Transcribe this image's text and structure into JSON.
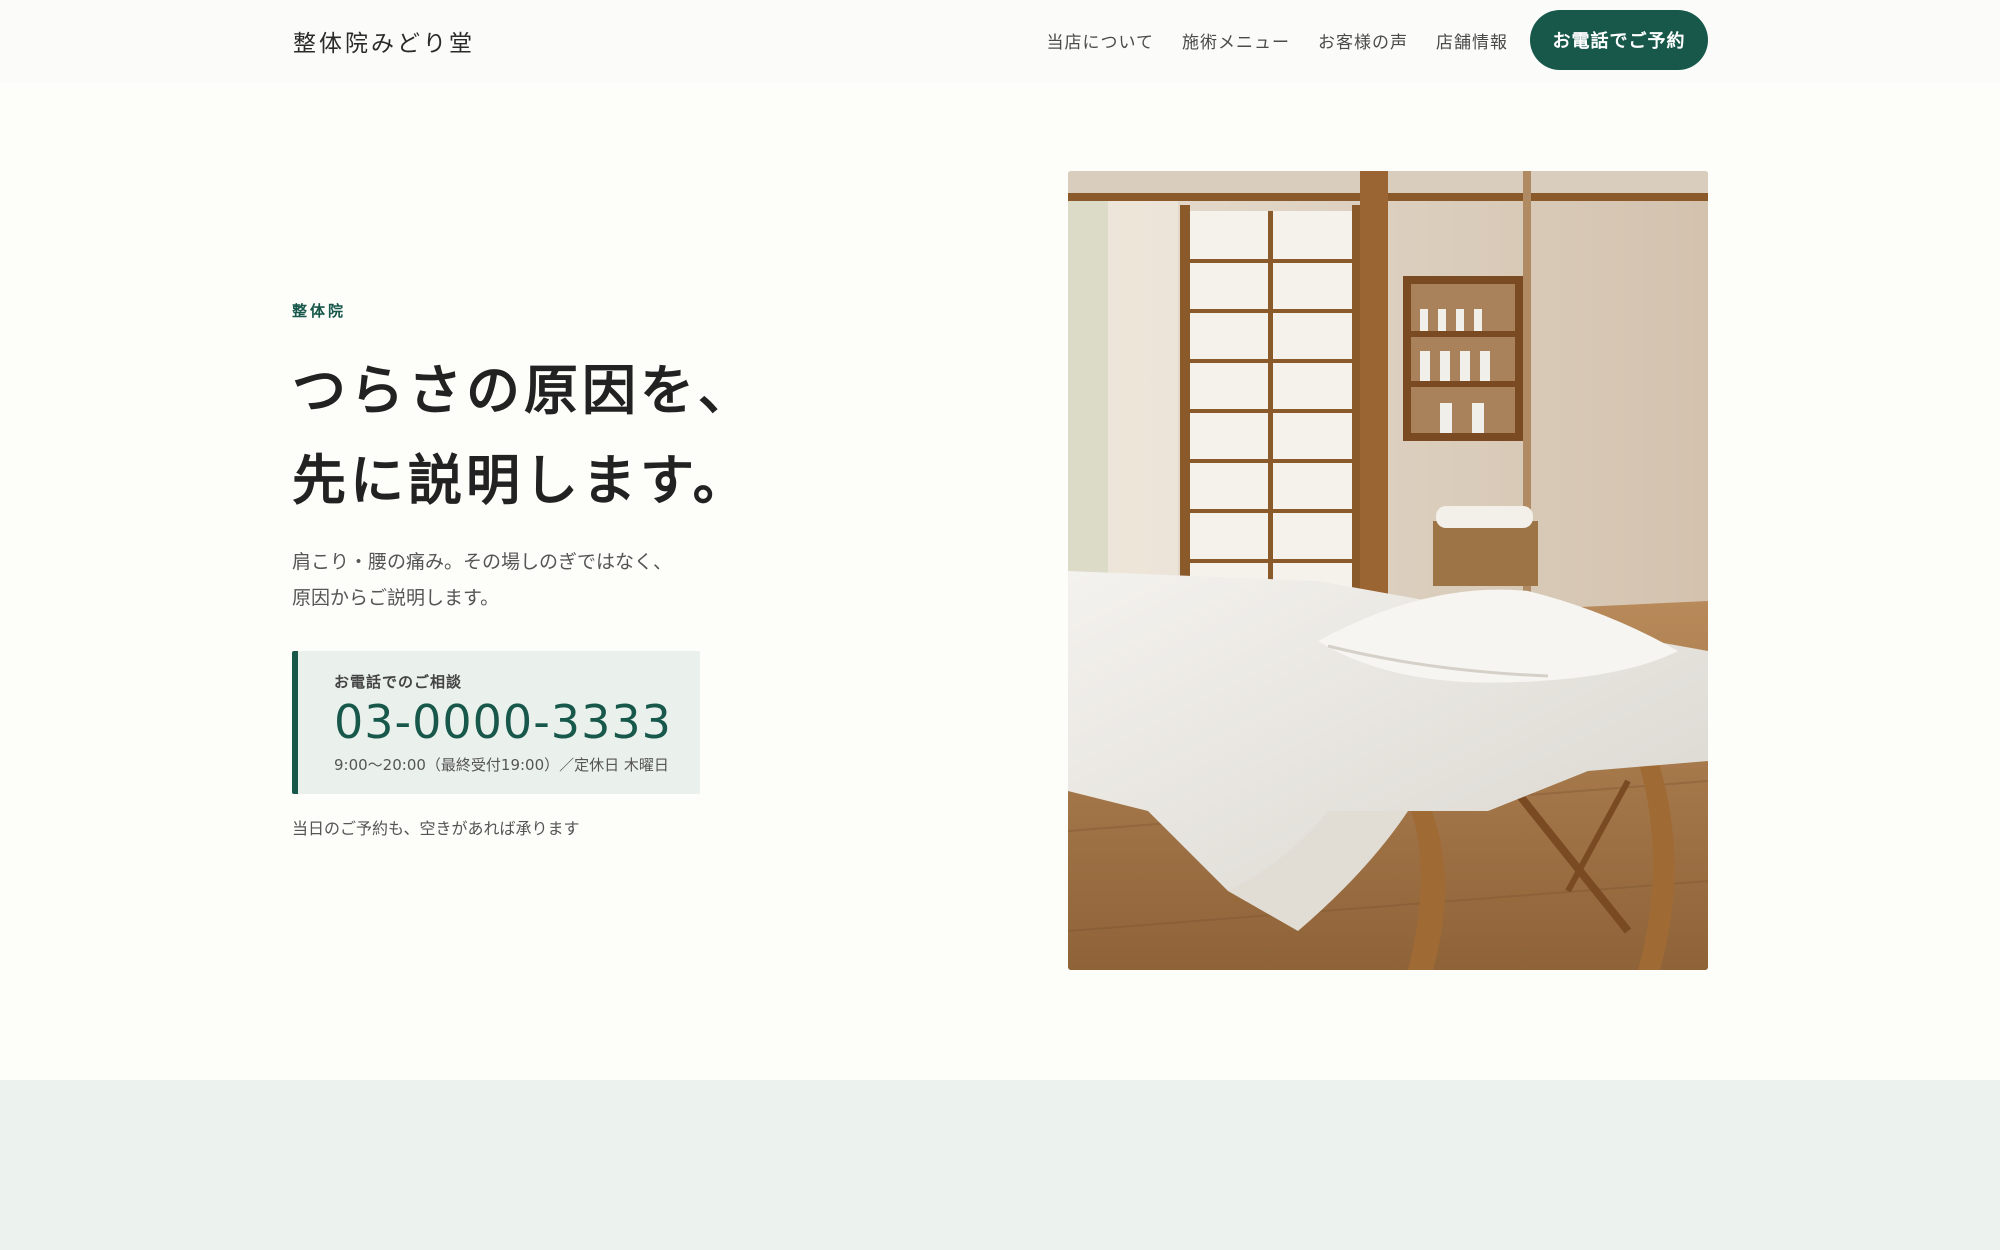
{
  "header": {
    "logo": "整体院みどり堂",
    "nav": [
      "当店について",
      "施術メニュー",
      "お客様の声",
      "店舗情報"
    ],
    "cta_label": "お電話でご予約"
  },
  "hero": {
    "eyebrow": "整体院",
    "headline": [
      "つらさの原因を、",
      "先に説明します。"
    ],
    "lead": [
      "肩こり・腰の痛み。その場しのぎではなく、",
      "原因からご説明します。"
    ],
    "phone": {
      "label": "お電話でのご相談",
      "number": "03-0000-3333",
      "hours": "9:00〜20:00（最終受付19:00）／定休日 木曜日"
    },
    "note": "当日のご予約も、空きがあれば承ります"
  },
  "colors": {
    "accent": "#17584b",
    "background": "#fdfdf9",
    "panel": "#eaf1ed"
  }
}
